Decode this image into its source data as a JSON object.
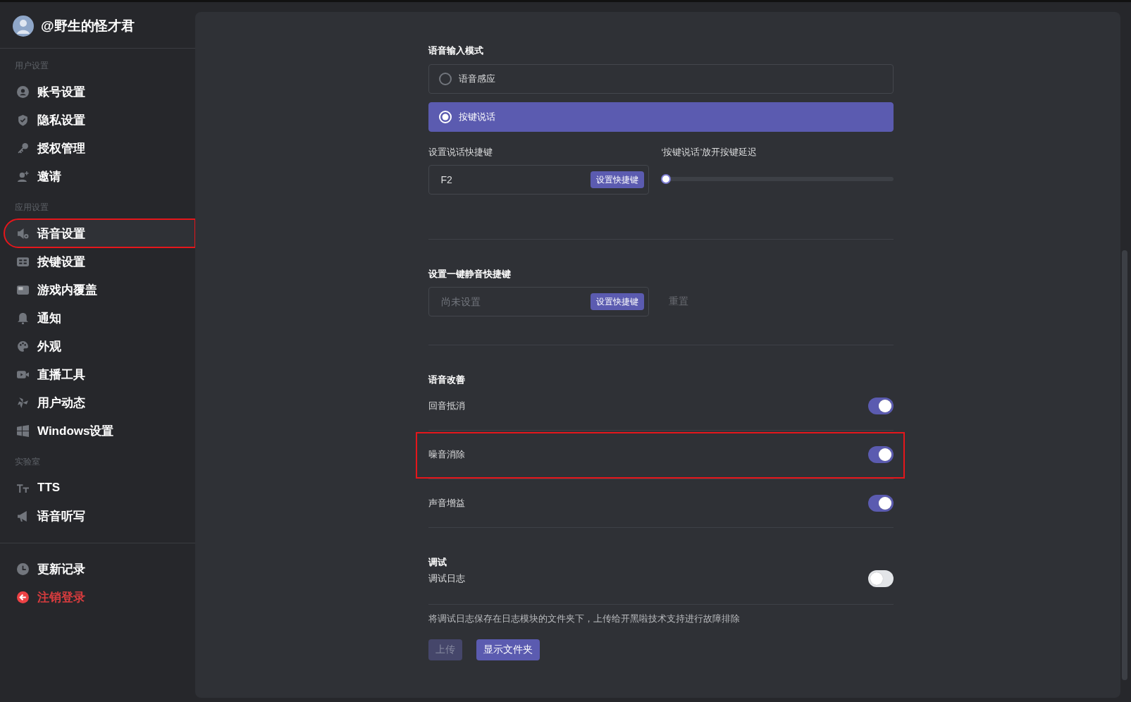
{
  "sidebar": {
    "user_name": "@野生的怪才君",
    "sections": [
      {
        "label": "用户设置",
        "items": [
          {
            "label": "账号设置",
            "selected": false,
            "highlighted": false
          },
          {
            "label": "隐私设置",
            "selected": false,
            "highlighted": false
          },
          {
            "label": "授权管理",
            "selected": false,
            "highlighted": false
          },
          {
            "label": "邀请",
            "selected": false,
            "highlighted": false
          }
        ]
      },
      {
        "label": "应用设置",
        "items": [
          {
            "label": "语音设置",
            "selected": true,
            "highlighted": true
          },
          {
            "label": "按键设置",
            "selected": false,
            "highlighted": false
          },
          {
            "label": "游戏内覆盖",
            "selected": false,
            "highlighted": false
          },
          {
            "label": "通知",
            "selected": false,
            "highlighted": false
          },
          {
            "label": "外观",
            "selected": false,
            "highlighted": false
          },
          {
            "label": "直播工具",
            "selected": false,
            "highlighted": false
          },
          {
            "label": "用户动态",
            "selected": false,
            "highlighted": false
          },
          {
            "label": "Windows设置",
            "selected": false,
            "highlighted": false
          }
        ]
      },
      {
        "label": "实验室",
        "items": [
          {
            "label": "TTS",
            "selected": false,
            "highlighted": false
          },
          {
            "label": "语音听写",
            "selected": false,
            "highlighted": false
          }
        ]
      }
    ],
    "footer_items": [
      {
        "label": "更新记录",
        "kind": "normal"
      },
      {
        "label": "注销登录",
        "kind": "danger"
      }
    ]
  },
  "main": {
    "input_mode": {
      "title": "语音输入模式",
      "options": [
        {
          "label": "语音感应",
          "selected": false
        },
        {
          "label": "按键说话",
          "selected": true
        }
      ]
    },
    "ptt_hotkey": {
      "label": "设置说话快捷键",
      "value": "F2",
      "button": "设置快捷键"
    },
    "release_delay": {
      "label": "‘按键说话’放开按键延迟",
      "level": 0
    },
    "mute_hotkey": {
      "label": "设置一键静音快捷键",
      "placeholder": "尚未设置",
      "button": "设置快捷键",
      "reset": "重置"
    },
    "enhancement": {
      "title": "语音改善",
      "toggles": [
        {
          "label": "回音抵消",
          "on": true,
          "highlighted": false
        },
        {
          "label": "噪音消除",
          "on": true,
          "highlighted": true
        },
        {
          "label": "声音增益",
          "on": true,
          "highlighted": false
        }
      ]
    },
    "debug": {
      "title": "调试",
      "toggle": {
        "label": "调试日志",
        "on": false
      },
      "description": "将调试日志保存在日志模块的文件夹下，上传给开黑啦技术支持进行故障排除",
      "buttons": [
        {
          "label": "上传",
          "disabled": true
        },
        {
          "label": "显示文件夹",
          "disabled": false
        }
      ]
    }
  }
}
